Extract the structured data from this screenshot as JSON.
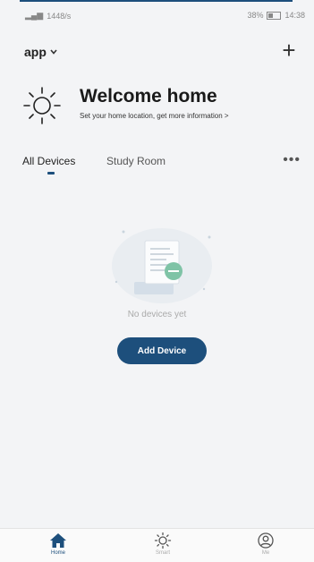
{
  "status_bar": {
    "signal": "▂▄▆",
    "network_speed": "1448/s",
    "battery": "38%",
    "time": "14:38"
  },
  "header": {
    "app_label": "app",
    "dropdown_glyph": "⌵",
    "add_glyph": "+"
  },
  "welcome": {
    "title": "Welcome home",
    "subtitle": "Set your home location, get more information >"
  },
  "tabs": [
    {
      "label": "All Devices",
      "active": true
    },
    {
      "label": "Study Room",
      "active": false
    }
  ],
  "more_glyph": "•••",
  "empty_state": {
    "message": "No devices yet",
    "button_label": "Add Device"
  },
  "nav": [
    {
      "label": "Home",
      "icon": "home-icon",
      "active": true
    },
    {
      "label": "Smart",
      "icon": "sun-icon",
      "active": false
    },
    {
      "label": "Me",
      "icon": "user-icon",
      "active": false
    }
  ],
  "colors": {
    "accent": "#1d4f7c",
    "background": "#f3f4f6"
  }
}
